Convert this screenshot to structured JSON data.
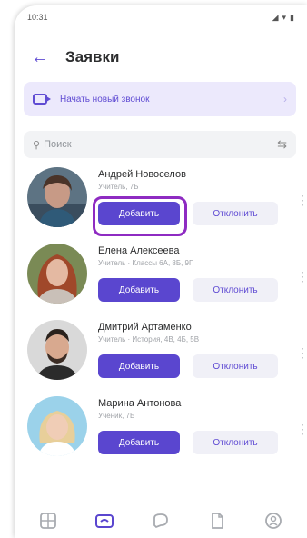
{
  "status_bar": {
    "time": "10:31",
    "icons": [
      "signal-icon",
      "wifi-icon",
      "battery-icon"
    ]
  },
  "header": {
    "title": "Заявки",
    "back_icon": "arrow-left-icon"
  },
  "invite_banner": {
    "label": "Начать новый звонок",
    "icon": "camera-icon"
  },
  "search": {
    "placeholder": "Поиск",
    "icon": "search-icon",
    "filter_icon": "filter-icon"
  },
  "requests": [
    {
      "name": "Андрей Новоселов",
      "subtitle": "Учитель, 7Б",
      "add_label": "Добавить",
      "decline_label": "Отклонить"
    },
    {
      "name": "Елена Алексеева",
      "subtitle": "Учитель · Классы 6А, 8Б, 9Г",
      "add_label": "Добавить",
      "decline_label": "Отклонить"
    },
    {
      "name": "Дмитрий Артаменко",
      "subtitle": "Учитель · История, 4В, 4Б, 5В",
      "add_label": "Добавить",
      "decline_label": "Отклонить"
    },
    {
      "name": "Марина Антонова",
      "subtitle": "Ученик, 7Б",
      "add_label": "Добавить",
      "decline_label": "Отклонить"
    }
  ],
  "tabbar": [
    "grid-icon",
    "calls-icon",
    "chat-icon",
    "document-icon",
    "profile-icon"
  ],
  "colors": {
    "accent": "#5a46cf",
    "banner_bg": "#ece9fc",
    "highlight": "#8e2bc2"
  }
}
